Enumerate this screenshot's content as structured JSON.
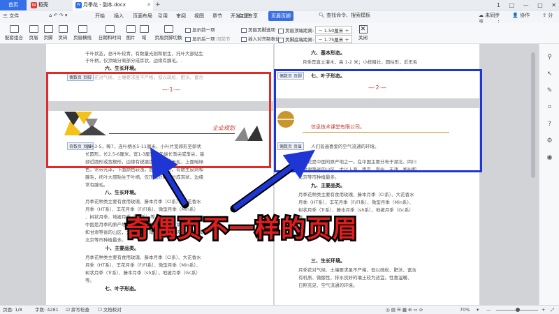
{
  "tabs": {
    "home": "首页",
    "wps": "稻壳",
    "doc": "月季花 - 副本.docx",
    "plus": "+"
  },
  "window_controls": [
    "1",
    "□",
    "—",
    "□",
    "✕"
  ],
  "menu": {
    "file": "三 文件",
    "items": [
      "开始",
      "插入",
      "页面布局",
      "引用",
      "审阅",
      "视图",
      "章节",
      "开发工具",
      "会员专享"
    ],
    "active": "页眉页脚",
    "search": "查找命令、搜索模板",
    "cloud": "未同步",
    "collab": "协作",
    "share": "分享"
  },
  "ribbon": {
    "big": [
      "配套组合",
      "页眉",
      "页脚",
      "页码",
      "页眉横线",
      "日期和时间",
      "图片",
      "域",
      "页眉页脚切换"
    ],
    "show_prev": "显示前一项",
    "show_next": "显示后一项",
    "same_prev": "同前节",
    "options": "页眉页脚选项",
    "insert_tab": "插入对齐制表位",
    "header_top": "页眉顶端距离:",
    "header_top_val": "1.50厘米",
    "footer_bottom": "页脚底端距离:",
    "footer_bottom_val": "1.75厘米",
    "close": "关闭"
  },
  "left_page": {
    "top_lines": [
      "干叶状态，总叶叶较青，有数量光则和耐生，托叶大部贴生",
      "于叶柄，仅顶端分离部分成耳状，边缘有腺毛。."
    ],
    "section6": "六、生长环境。",
    "footer1_line": "月季花对气候、土壤要求虽不严格，但以疏松、肥沃、富含",
    "footer_label": "偶数页 页脚",
    "pagenum": "—·1·—",
    "header_label": "奇数页 页眉",
    "company": "企业规划",
    "lines": [
      "小叶3-5，稀7，连叶柄长5-11厘米，小叶片宽卵形至卵状",
      "长圆形，长2.5-6厘米，宽1-3厘米，先端长渐尖或渐尖，基",
      "部近圆形或宽楔形，边缘有锐锯齿，两面近无毛，上面暗绿",
      "色，常带光泽，下面颜色较浅，总叶柄较长，有散生皮刺和",
      "腺毛，托叶大部贴生于叶柄，仅顶端分离部分成耳状，边缘",
      "常有腺毛。."
    ],
    "section8": "八、生长环境。",
    "env_lines": [
      "月季花种类主要有食用玫瑰、藤本月季（Cl系）、大花香水",
      "月季（HT系）、丰花月季（F/Fl系）、微型月季（Min系）",
      "、树状月季、地被月季（Gc系）等。",
      "中国是月季的原产地之一。在中国主要分布于湖北、四川",
      "和甘肃等省的山区，尤以上海、南京、常州、天津、郑州和",
      "北京等市种植最多。"
    ],
    "section_pin": "十、主要品类。",
    "pin_lines": [
      "月季花种类主要有食用玫瑰、藤本月季（Cl系）、大花香水",
      "月季（HT系）、丰花月季（F/Fl系）、微型月季（Min系）、",
      "树状月季（Tr系）、藤本月季（sh系），地被月季（Gc系）",
      "等。"
    ],
    "section7": "七、叶子形态。"
  },
  "right_page": {
    "top_section": "六、基本形态。",
    "top_lines": [
      "月季是直立灌木，高 1-2 米；小枝粗壮，圆柱形，近无毛"
    ],
    "footer_label": "偶数页 页脚",
    "section7": "七、叶子形态。",
    "pagenum": "—·2·—",
    "company": "信息技术课堂有限公司。",
    "header_label": "偶数页 页眉",
    "line_after": "人们普遍喜爱的空气流通的环境。",
    "lines": [
      "月季花是中国的原产地之一。在中国主要分布于湖北、四川",
      "和甘肃等省的山区，尤以上海、南京、常州、天津、郑州和",
      "北京等市种植最多。"
    ],
    "section9": "九、主要品类。",
    "pin_lines": [
      "月季花种类主要有食用玫瑰、藤本月季（Cl系）、大花香水",
      "月季（HT系）、丰花月季（F/Fl系）、微型月季（Min系）、",
      "树状月季（Tr系）、藤本月季（sh系），地被月季（Gc系）",
      "等。"
    ],
    "section3": "三、生长环境。",
    "env_lines": [
      "月季花对气候、土壤要求虽不严格，但以疏松、肥沃、富含",
      "有机质、微酸性、排水良好的壤土较为适宜。性喜温暖、",
      "日照充足、空气流通的环境。"
    ]
  },
  "caption": "奇偶页不一样的页眉",
  "status": {
    "page": "页面: 1/8",
    "words": "字数: 4281",
    "spell": "拼写检查",
    "proof": "文档校对",
    "zoom": "70%",
    "zoom_minus": "—",
    "zoom_plus": "+"
  },
  "colors": {
    "accent": "#3a6fe0",
    "red_box": "#e12a2a",
    "blue_box": "#1f36d6",
    "caption": "#e11d1d"
  }
}
